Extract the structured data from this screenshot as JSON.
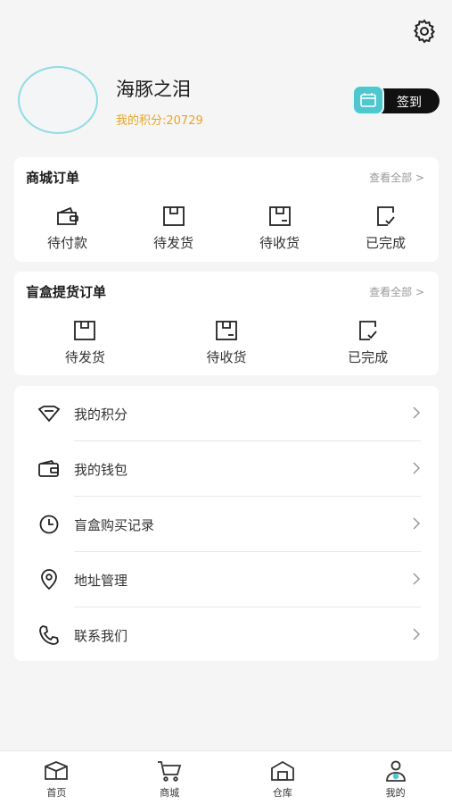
{
  "header": {
    "settings_icon": "gear-icon"
  },
  "profile": {
    "username": "海豚之泪",
    "points_label": "我的积分:20729",
    "sign_in_label": "签到"
  },
  "mall_orders": {
    "title": "商城订单",
    "view_all": "查看全部 >",
    "items": [
      {
        "label": "待付款",
        "icon": "wallet-icon"
      },
      {
        "label": "待发货",
        "icon": "box-icon"
      },
      {
        "label": "待收货",
        "icon": "box-receive-icon"
      },
      {
        "label": "已完成",
        "icon": "done-doc-icon"
      }
    ]
  },
  "blindbox_orders": {
    "title": "盲盒提货订单",
    "view_all": "查看全部 >",
    "items": [
      {
        "label": "待发货",
        "icon": "box-icon"
      },
      {
        "label": "待收货",
        "icon": "box-receive-icon"
      },
      {
        "label": "已完成",
        "icon": "done-doc-icon"
      }
    ]
  },
  "menu": {
    "items": [
      {
        "label": "我的积分",
        "icon": "diamond-icon"
      },
      {
        "label": "我的钱包",
        "icon": "wallet-icon"
      },
      {
        "label": "盲盒购买记录",
        "icon": "clock-icon"
      },
      {
        "label": "地址管理",
        "icon": "location-icon"
      },
      {
        "label": "联系我们",
        "icon": "phone-icon"
      }
    ]
  },
  "tabbar": {
    "items": [
      {
        "label": "首页",
        "icon": "box-home-icon"
      },
      {
        "label": "商城",
        "icon": "cart-icon"
      },
      {
        "label": "仓库",
        "icon": "warehouse-icon"
      },
      {
        "label": "我的",
        "icon": "user-icon",
        "active": true
      }
    ]
  },
  "colors": {
    "accent": "#4fc7cf",
    "points": "#e7a622",
    "background": "#f5f5f5"
  }
}
